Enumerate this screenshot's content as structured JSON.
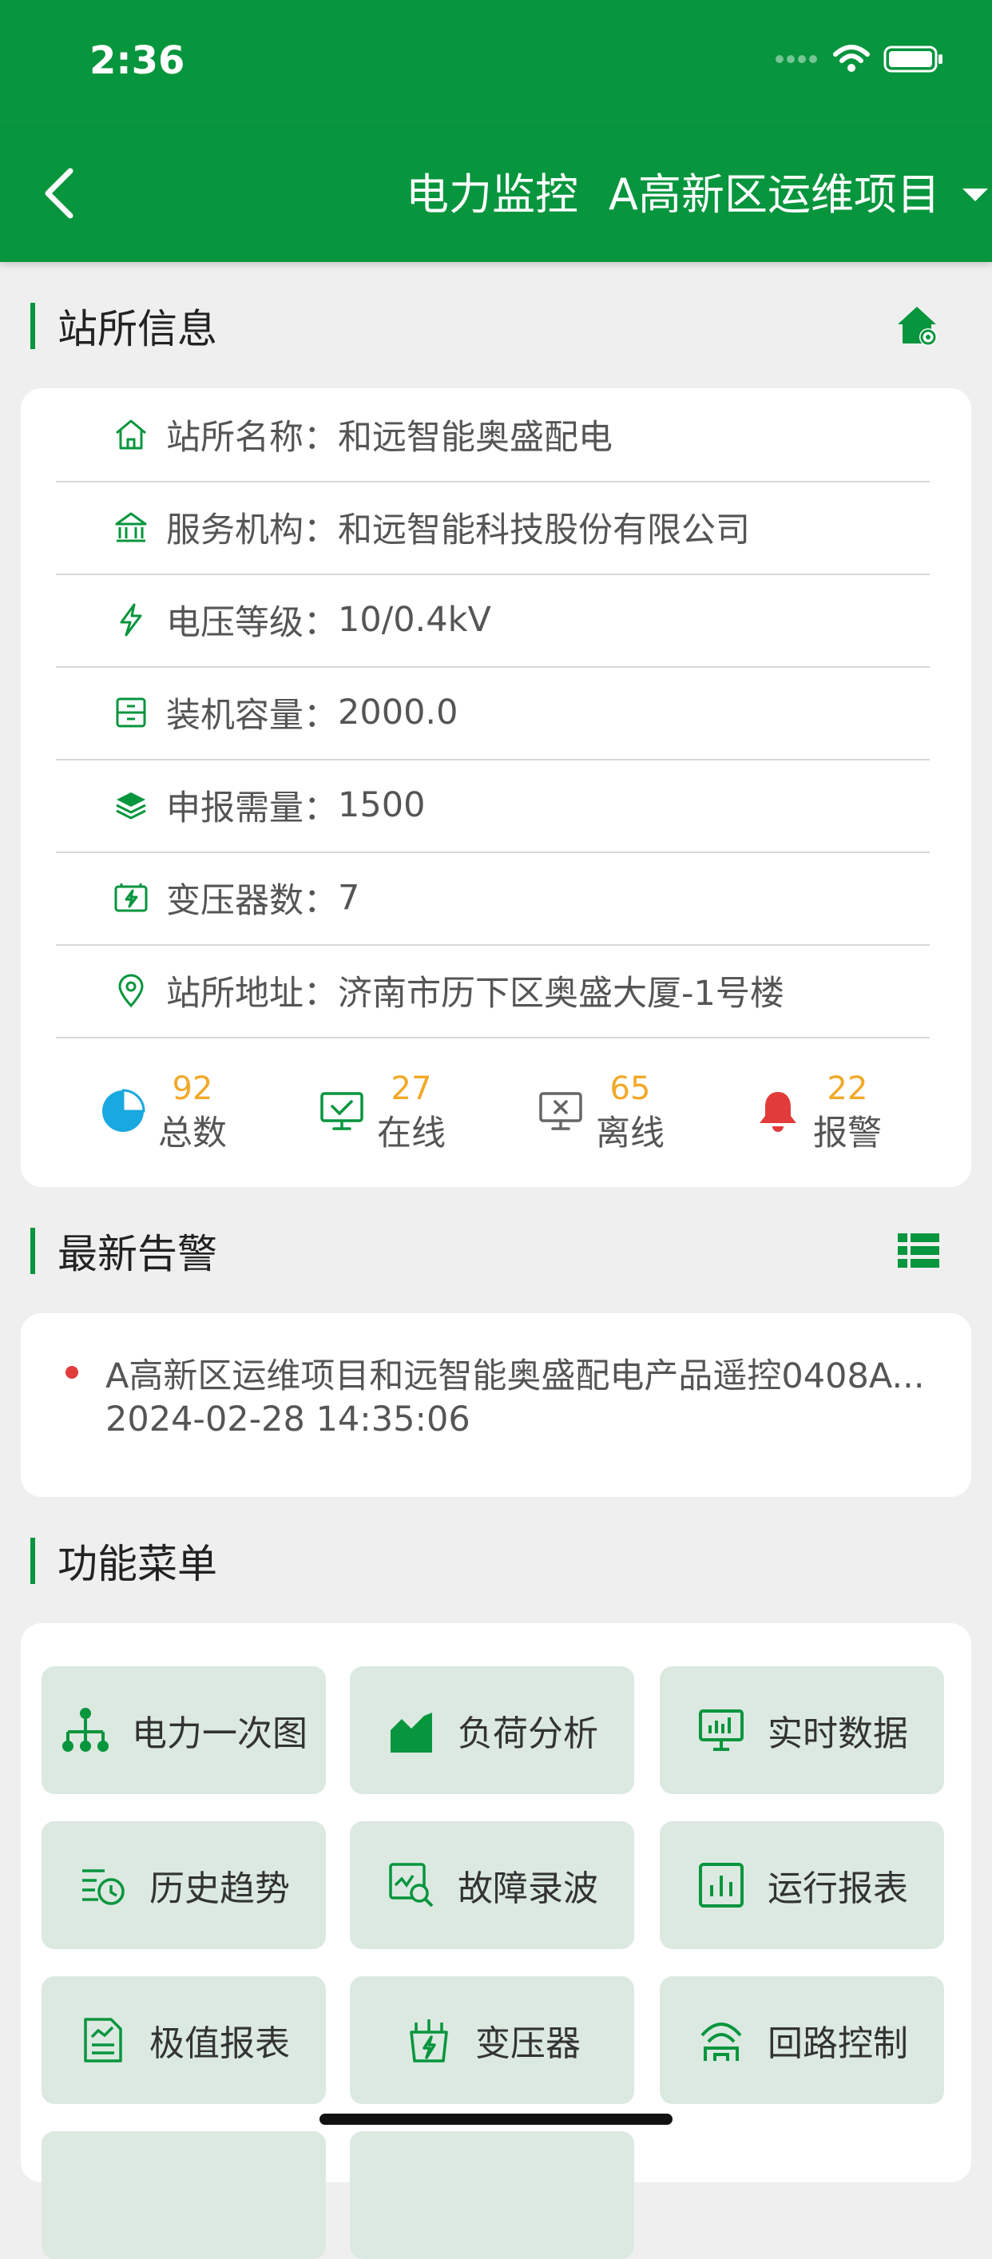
{
  "status_bar": {
    "time": "2:36"
  },
  "nav": {
    "title": "电力监控",
    "project": "A高新区运维项目"
  },
  "station_section": {
    "title": "站所信息"
  },
  "station_info": [
    {
      "icon": "house-icon",
      "label": "站所名称：",
      "value": "和远智能奥盛配电"
    },
    {
      "icon": "institution-icon",
      "label": "服务机构：",
      "value": "和远智能科技股份有限公司"
    },
    {
      "icon": "lightning-icon",
      "label": "电压等级：",
      "value": "10/0.4kV"
    },
    {
      "icon": "cabinet-icon",
      "label": "装机容量：",
      "value": "2000.0"
    },
    {
      "icon": "layers-icon",
      "label": "申报需量：",
      "value": "1500"
    },
    {
      "icon": "battery-icon",
      "label": "变压器数：",
      "value": "7"
    },
    {
      "icon": "location-pin-icon",
      "label": "站所地址：",
      "value": "济南市历下区奥盛大厦-1号楼"
    }
  ],
  "stats": [
    {
      "icon": "pie-icon",
      "value": "92",
      "label": "总数"
    },
    {
      "icon": "monitor-check-icon",
      "value": "27",
      "label": "在线"
    },
    {
      "icon": "monitor-x-icon",
      "value": "65",
      "label": "离线"
    },
    {
      "icon": "bell-icon",
      "value": "22",
      "label": "报警"
    }
  ],
  "alarm_section": {
    "title": "最新告警"
  },
  "alarm": {
    "text": "A高新区运维项目和远智能奥盛配电产品遥控0408A...",
    "time": "2024-02-28 14:35:06"
  },
  "menu_section": {
    "title": "功能菜单"
  },
  "menu": [
    {
      "icon": "hierarchy-icon",
      "label": "电力一次图"
    },
    {
      "icon": "area-chart-icon",
      "label": "负荷分析"
    },
    {
      "icon": "monitor-chart-icon",
      "label": "实时数据"
    },
    {
      "icon": "history-icon",
      "label": "历史趋势"
    },
    {
      "icon": "wave-search-icon",
      "label": "故障录波"
    },
    {
      "icon": "bar-report-icon",
      "label": "运行报表"
    },
    {
      "icon": "report-icon",
      "label": "极值报表"
    },
    {
      "icon": "transformer-icon",
      "label": "变压器"
    },
    {
      "icon": "circuit-icon",
      "label": "回路控制"
    }
  ],
  "colors": {
    "brand": "#07953d",
    "accent_number": "#f1a928",
    "alarm": "#e23b3b",
    "pie": "#1aa8e0",
    "menu_bg": "#dbe9e1"
  }
}
